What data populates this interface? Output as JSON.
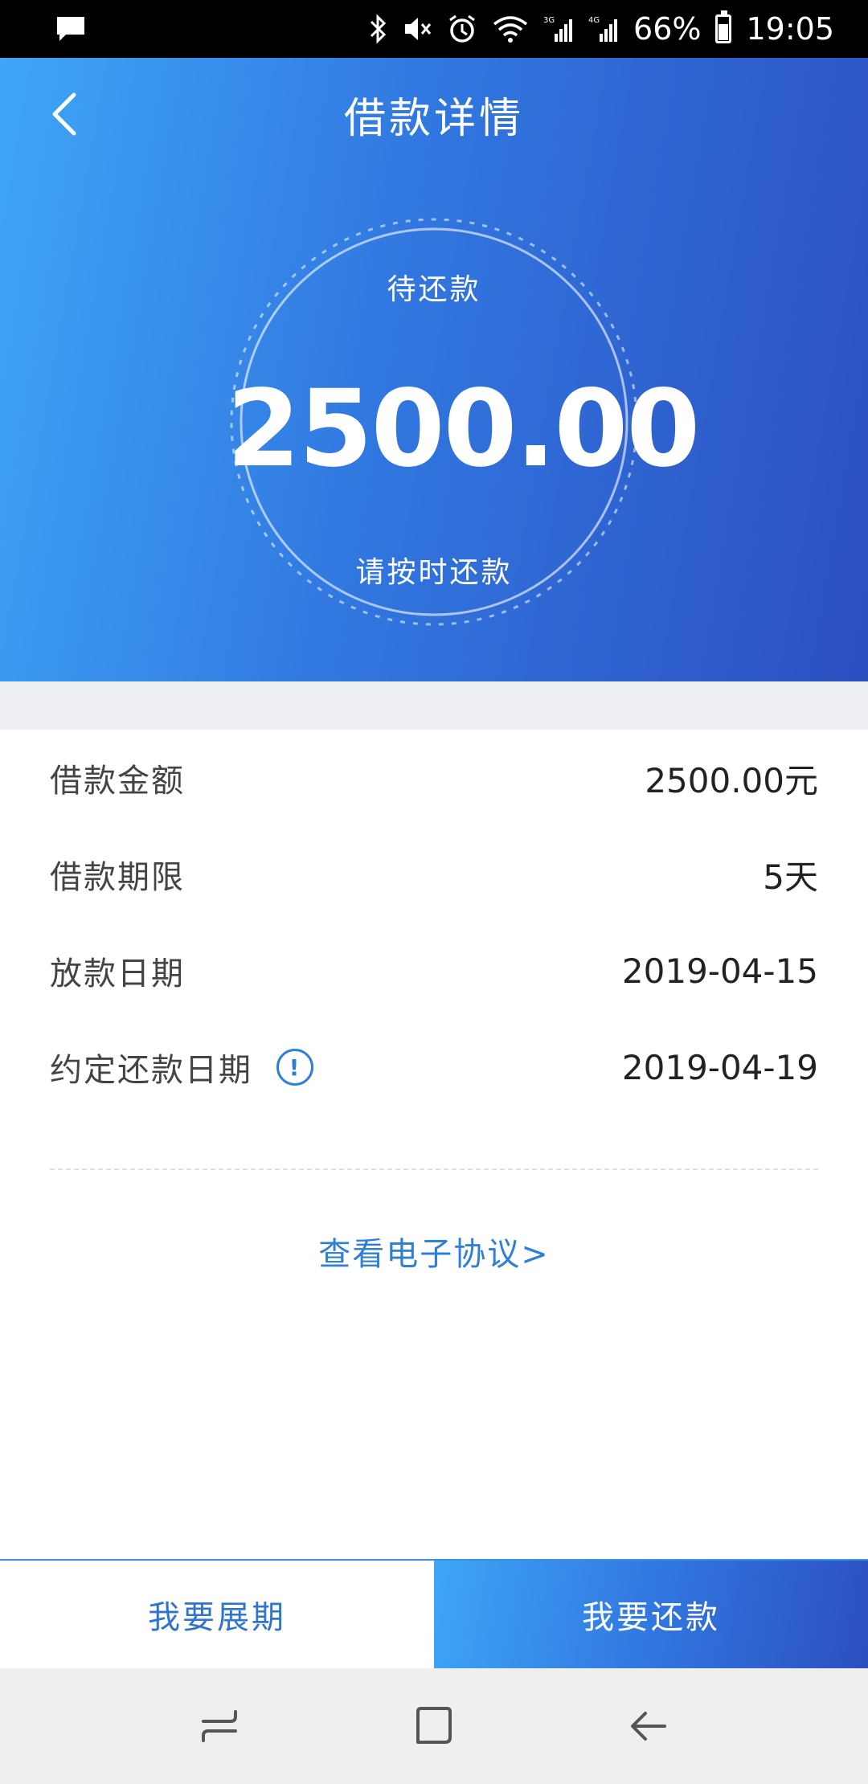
{
  "status_bar": {
    "battery": "66%",
    "time": "19:05",
    "icons": [
      "message-icon",
      "bluetooth-icon",
      "mute-icon",
      "alarm-icon",
      "wifi-icon",
      "signal-3g-icon",
      "signal-4g-icon",
      "battery-icon"
    ],
    "battery_level": 0.66
  },
  "header": {
    "title": "借款详情",
    "back_icon": "chevron-left-icon"
  },
  "summary": {
    "top_label": "待还款",
    "amount": "2500.00",
    "bottom_label": "请按时还款"
  },
  "details": [
    {
      "label": "借款金额",
      "value": "2500.00元"
    },
    {
      "label": "借款期限",
      "value": "5天"
    },
    {
      "label": "放款日期",
      "value": "2019-04-15"
    },
    {
      "label": "约定还款日期",
      "value": "2019-04-19",
      "info_icon": "!"
    }
  ],
  "agreement_link": "查看电子协议>",
  "actions": {
    "extend_label": "我要展期",
    "repay_label": "我要还款"
  },
  "colors": {
    "gradient_start": "#3ea6f6",
    "gradient_end": "#2c4fc0",
    "accent": "#2f80d4"
  },
  "system_nav": [
    "recent-apps-icon",
    "home-icon",
    "back-icon"
  ]
}
